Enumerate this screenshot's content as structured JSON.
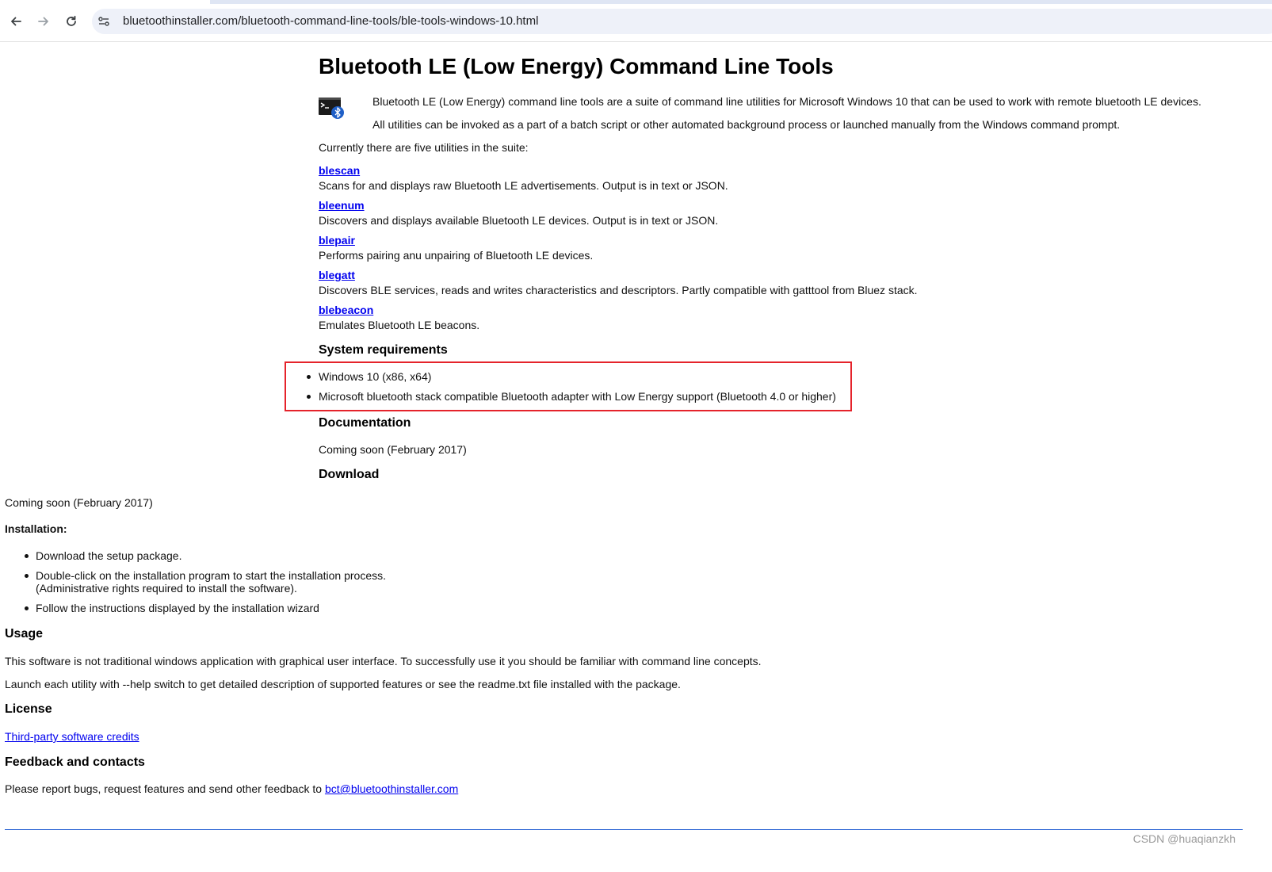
{
  "browser": {
    "url": "bluetoothinstaller.com/bluetooth-command-line-tools/ble-tools-windows-10.html",
    "icons": [
      "back-arrow-icon",
      "forward-arrow-icon",
      "reload-icon",
      "site-info-icon"
    ]
  },
  "page": {
    "title": "Bluetooth LE (Low Energy) Command Line Tools",
    "intro1": "Bluetooth LE (Low Energy) command line tools are a suite of command line utilities for Microsoft Windows 10 that can be used to work with remote bluetooth LE devices.",
    "intro2": "All utilities can be invoked as a part of a batch script or other automated background process or launched manually from the Windows command prompt.",
    "suite_intro": "Currently there are five utilities in the suite:",
    "tools": [
      {
        "name": "blescan",
        "desc": "Scans for and displays raw Bluetooth LE advertisements. Output is in text or JSON."
      },
      {
        "name": "bleenum",
        "desc": "Discovers and displays available Bluetooth LE devices. Output is in text or JSON."
      },
      {
        "name": "blepair",
        "desc": "Performs pairing anu unpairing of Bluetooth LE devices."
      },
      {
        "name": "blegatt",
        "desc": "Discovers BLE services, reads and writes characteristics and descriptors. Partly compatible with gatttool from Bluez stack."
      },
      {
        "name": "blebeacon",
        "desc": "Emulates Bluetooth LE beacons."
      }
    ],
    "sysreq_heading": "System requirements",
    "sysreq": [
      "Windows 10 (x86, x64)",
      "Microsoft bluetooth stack compatible Bluetooth adapter with Low Energy support (Bluetooth 4.0 or higher)"
    ],
    "doc_heading": "Documentation",
    "doc_text": "Coming soon (February 2017)",
    "download_heading": "Download",
    "download_text": "Coming soon (February 2017)",
    "install_heading": "Installation:",
    "install_steps": [
      "Download the setup package.",
      "Double-click on the installation program to start the installation process.",
      "(Administrative rights required to install the software).",
      "Follow the instructions displayed by the installation wizard"
    ],
    "usage_heading": "Usage",
    "usage1": "This software is not traditional windows application with graphical user interface. To successfully use it you should be familiar with command line concepts.",
    "usage2": "Launch each utility with --help switch to get detailed description of supported features or see the readme.txt file installed with the package.",
    "license_heading": "License",
    "license_link": "Third-party software credits",
    "feedback_heading": "Feedback and contacts",
    "feedback_text": "Please report bugs, request features and send other feedback to",
    "feedback_email": "bct@bluetoothinstaller.com",
    "watermark": "CSDN @huaqianzkh"
  },
  "colors": {
    "link": "#0000ee",
    "highlight_box": "#e5232b",
    "footer_line": "#2e66d4",
    "omnibox": "#eef1f9"
  }
}
